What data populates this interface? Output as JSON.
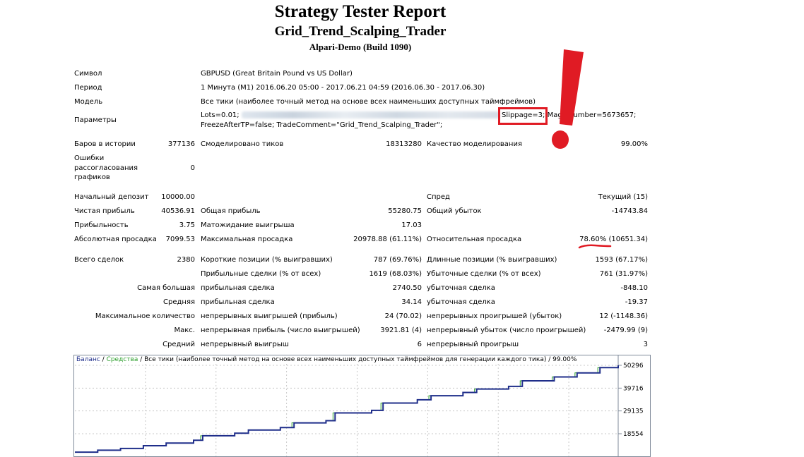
{
  "header": {
    "title": "Strategy Tester Report",
    "expert": "Grid_Trend_Scalping_Trader",
    "server": "Alpari-Demo (Build 1090)"
  },
  "info": {
    "symbol_label": "Символ",
    "symbol_value": "GBPUSD (Great Britain Pound vs US Dollar)",
    "period_label": "Период",
    "period_value": "1 Минута (M1) 2016.06.20 05:00 - 2017.06.21 04:59 (2016.06.30 - 2017.06.30)",
    "model_label": "Модель",
    "model_value": "Все тики (наиболее точный метод на основе всех наименьших доступных таймфреймов)",
    "params_label": "Параметры",
    "params_line1_start": "Lots=0.01;",
    "params_slippage": "Slippage=3;",
    "params_line1_end": "MagicNumber=5673657;",
    "params_line2": "FreezeAfterTP=false; TradeComment=\"Grid_Trend_Scalping_Trader\";"
  },
  "stats": {
    "bars_label": "Баров в истории",
    "bars_value": "377136",
    "ticks_label": "Смоделировано тиков",
    "ticks_value": "18313280",
    "quality_label": "Качество моделирования",
    "quality_value": "99.00%",
    "errors_label_1": "Ошибки",
    "errors_label_2": "рассогласования",
    "errors_label_3": "графиков",
    "errors_value": "0",
    "deposit_label": "Начальный депозит",
    "deposit_value": "10000.00",
    "spread_label": "Спред",
    "spread_value": "Текущий (15)",
    "net_label": "Чистая прибыль",
    "net_value": "40536.91",
    "gross_profit_label": "Общая прибыль",
    "gross_profit_value": "55280.75",
    "gross_loss_label": "Общий убыток",
    "gross_loss_value": "-14743.84",
    "pf_label": "Прибыльность",
    "pf_value": "3.75",
    "payoff_label": "Матожидание выигрыша",
    "payoff_value": "17.03",
    "abs_dd_label": "Абсолютная просадка",
    "abs_dd_value": "7099.53",
    "max_dd_label": "Максимальная просадка",
    "max_dd_value": "20978.88 (61.11%)",
    "rel_dd_label": "Относительная просадка",
    "rel_dd_pct": "78.60%",
    "rel_dd_abs": "(10651.34)",
    "total_label": "Всего сделок",
    "total_value": "2380",
    "short_label": "Короткие позиции (% выигравших)",
    "short_value": "787 (69.76%)",
    "long_label": "Длинные позиции (% выигравших)",
    "long_value": "1593 (67.17%)",
    "profit_trades_label": "Прибыльные сделки (% от всех)",
    "profit_trades_value": "1619 (68.03%)",
    "loss_trades_label": "Убыточные сделки (% от всех)",
    "loss_trades_value": "761 (31.97%)",
    "largest_label": "Самая большая",
    "largest_p_label": "прибыльная сделка",
    "largest_p_value": "2740.50",
    "largest_l_label": "убыточная сделка",
    "largest_l_value": "-848.10",
    "avg_label": "Средняя",
    "avg_p_label": "прибыльная сделка",
    "avg_p_value": "34.14",
    "avg_l_label": "убыточная сделка",
    "avg_l_value": "-19.37",
    "maxcnt_label": "Максимальное количество",
    "maxcnt_w_label": "непрерывных выигрышей (прибыль)",
    "maxcnt_w_value": "24 (70.02)",
    "maxcnt_l_label": "непрерывных проигрышей (убыток)",
    "maxcnt_l_value": "12 (-1148.36)",
    "maxp_label": "Макс.",
    "maxp_w_label": "непрерывная прибыль (число выигрышей)",
    "maxp_w_value": "3921.81 (4)",
    "maxp_l_label": "непрерывный убыток (число проигрышей)",
    "maxp_l_value": "-2479.99 (9)",
    "avgc_label": "Средний",
    "avgc_w_label": "непрерывный выигрыш",
    "avgc_w_value": "6",
    "avgc_l_label": "непрерывный проигрыш",
    "avgc_l_value": "3"
  },
  "chart_data": {
    "type": "line",
    "caption_balance": "Баланс",
    "caption_sep": " / ",
    "caption_equity": "Средства",
    "caption_rest": " / Все тики (наиболее точный метод на основе всех наименьших доступных таймфреймов для генерации каждого тика) / 99.00%",
    "y_ticks": [
      "50296",
      "39716",
      "29135",
      "18554"
    ],
    "y_tick_values": [
      50296,
      39716,
      29135,
      18554
    ],
    "trade_index_max": 2380,
    "series": [
      {
        "name": "Баланс",
        "color": "#1f2e8a",
        "x": [
          0,
          100,
          200,
          300,
          400,
          520,
          560,
          700,
          760,
          900,
          960,
          1100,
          1140,
          1300,
          1350,
          1500,
          1560,
          1700,
          1760,
          1900,
          1960,
          2100,
          2200,
          2300,
          2380
        ],
        "y": [
          10000,
          10900,
          11700,
          13000,
          14200,
          15500,
          17600,
          18800,
          20300,
          21400,
          23600,
          24600,
          28200,
          29400,
          32800,
          34300,
          36200,
          37700,
          39300,
          40500,
          43100,
          44900,
          46800,
          49200,
          50296
        ]
      }
    ],
    "equity_color": "#2a9d2a",
    "grid": true
  }
}
